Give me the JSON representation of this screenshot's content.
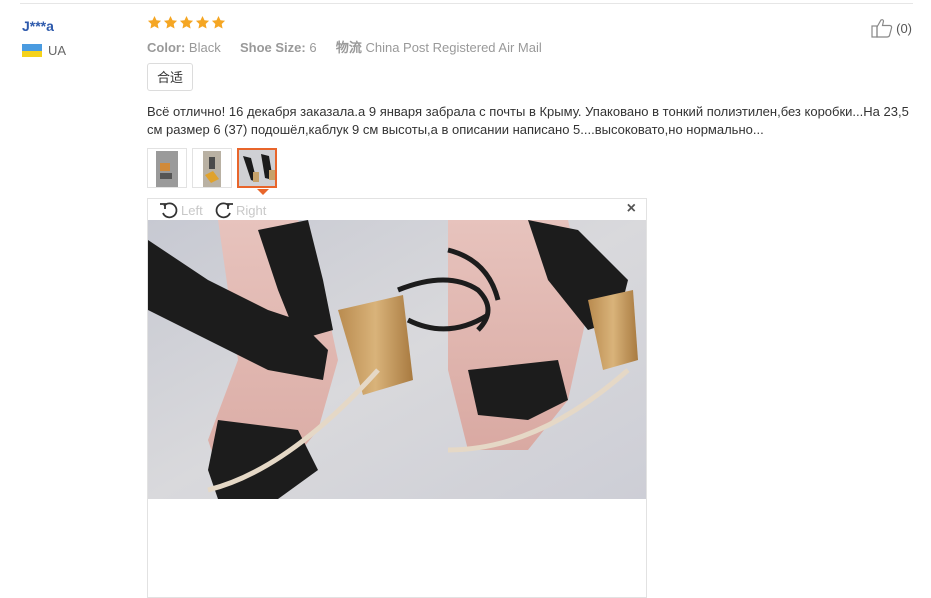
{
  "reviewer": {
    "name": "J***a",
    "country": "UA"
  },
  "rating": {
    "stars": 5,
    "color": "#f5a623"
  },
  "helpful": {
    "count": "(0)"
  },
  "attributes": [
    {
      "key": "Color:",
      "value": "Black"
    },
    {
      "key": "Shoe Size:",
      "value": "6"
    },
    {
      "key": "物流",
      "value": "China Post Registered Air Mail"
    }
  ],
  "tag": "合适",
  "review_text": "Всё отлично! 16 декабря заказала.а 9 января забрала с почты в Крыму. Упаковано в тонкий полиэтилен,без коробки...На 23,5 см размер 6 (37) подошёл,каблук 9 см высоты,а в описании написано 5....высоковато,но нормально...",
  "thumbnails": [
    {
      "icon": "photo-thumbnail-1",
      "active": false
    },
    {
      "icon": "photo-thumbnail-2",
      "active": false
    },
    {
      "icon": "photo-thumbnail-3",
      "active": true
    }
  ],
  "viewer": {
    "rotate_left": "Left",
    "rotate_right": "Right",
    "close_icon": "close-icon",
    "image_subject": "sandals-photo"
  },
  "colors": {
    "accent": "#e8652b",
    "link": "#2e5aac"
  }
}
